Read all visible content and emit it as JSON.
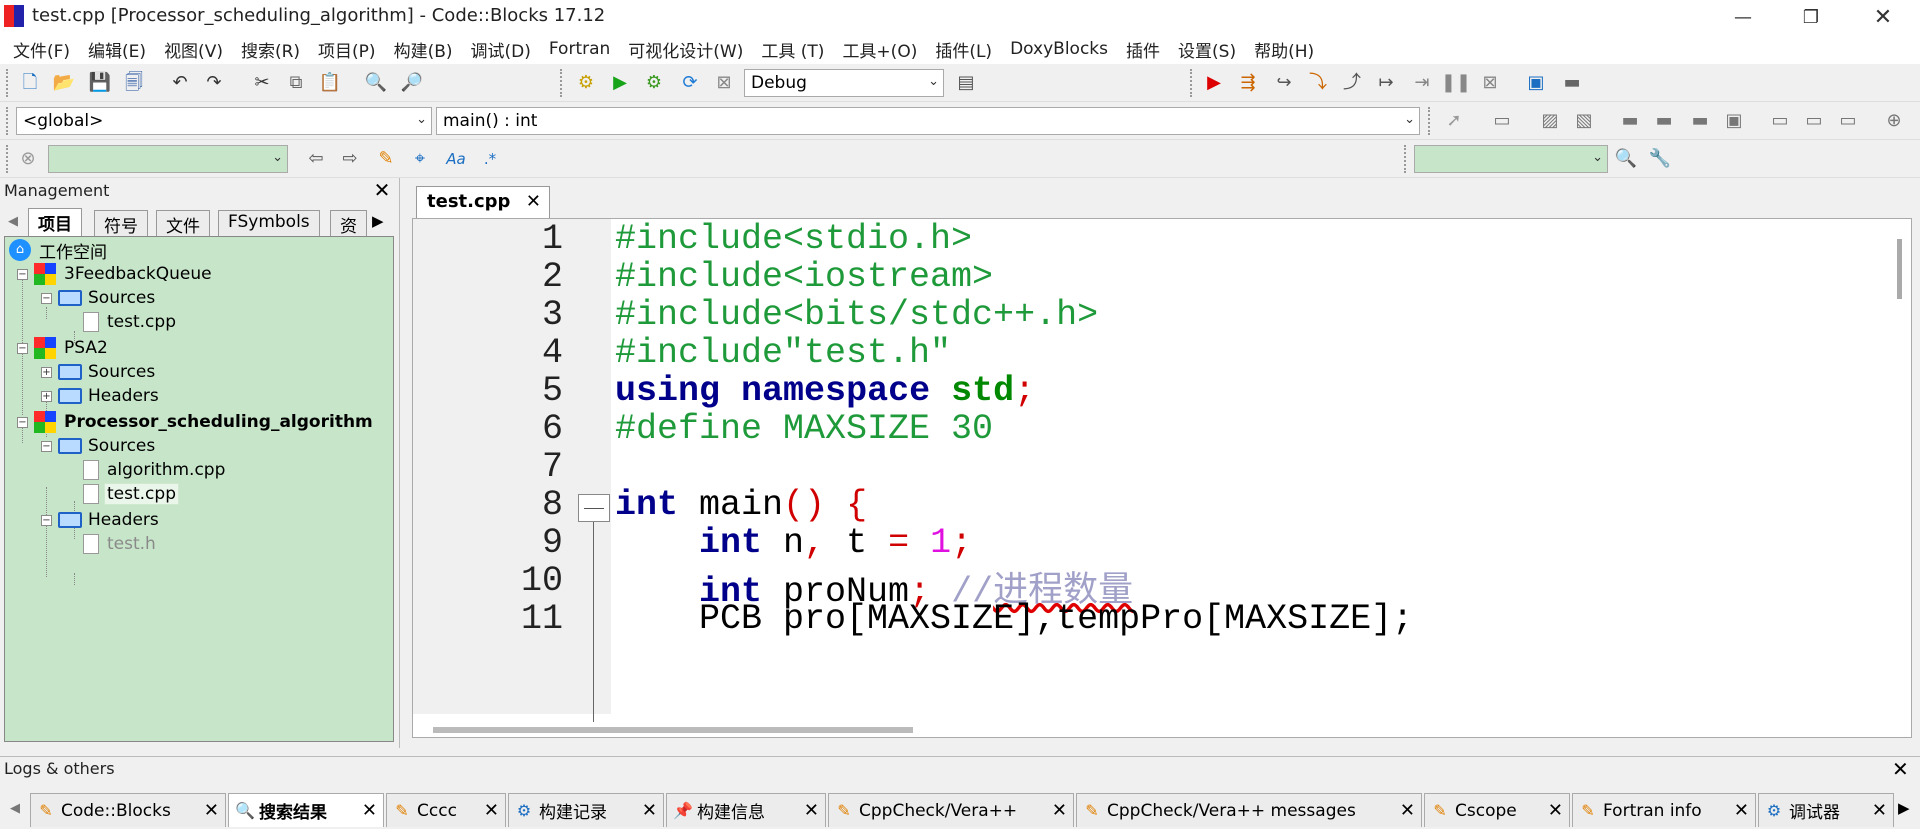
{
  "window": {
    "title": "test.cpp [Processor_scheduling_algorithm] - Code::Blocks 17.12"
  },
  "menu": [
    "文件(F)",
    "编辑(E)",
    "视图(V)",
    "搜索(R)",
    "项目(P)",
    "构建(B)",
    "调试(D)",
    "Fortran",
    "可视化设计(W)",
    "工具 (T)",
    "工具+(O)",
    "插件(L)",
    "DoxyBlocks",
    "插件",
    "设置(S)",
    "帮助(H)"
  ],
  "toolbar": {
    "build_target": "Debug",
    "scope": "<global>",
    "function": "main() : int"
  },
  "management": {
    "title": "Management",
    "tabs": [
      "项目",
      "符号",
      "文件",
      "FSymbols",
      "资"
    ],
    "tree": {
      "workspace": "工作空间",
      "p1": {
        "name": "3FeedbackQueue",
        "sources": "Sources",
        "f1": "test.cpp"
      },
      "p2": {
        "name": "PSA2",
        "sources": "Sources",
        "headers": "Headers"
      },
      "p3": {
        "name": "Processor_scheduling_algorithm",
        "sources": "Sources",
        "f1": "algorithm.cpp",
        "f2": "test.cpp",
        "headers": "Headers",
        "h1": "test.h"
      }
    }
  },
  "editor": {
    "tab": "test.cpp",
    "line_numbers": [
      "1",
      "2",
      "3",
      "4",
      "5",
      "6",
      "7",
      "8",
      "9",
      "10",
      "11"
    ],
    "lines": {
      "l1": "#include<stdio.h>",
      "l2": "#include<iostream>",
      "l3": "#include<bits/stdc++.h>",
      "l4": "#include\"test.h\"",
      "l5_kw1": "using",
      "l5_kw2": "namespace",
      "l5_ns": "std",
      "l5_semi": ";",
      "l6": "#define MAXSIZE 30",
      "l8_kw": "int",
      "l8_name": " main",
      "l8_paren": "()",
      "l8_brace": "{",
      "l9_kw": "int",
      "l9_a": " n",
      "l9_comma": ",",
      "l9_b": " t ",
      "l9_eq": "=",
      "l9_num": "1",
      "l9_semi": ";",
      "l10_kw": "int",
      "l10_name": " proNum",
      "l10_semi": ";",
      "l10_cm": "//",
      "l10_cmz": "进程数量",
      "l11": "PCB pro[MAXSIZE],tempPro[MAXSIZE];"
    }
  },
  "logs": {
    "title": "Logs & others",
    "tabs": [
      "Code::Blocks",
      "搜索结果",
      "Cccc",
      "构建记录",
      "构建信息",
      "CppCheck/Vera++",
      "CppCheck/Vera++ messages",
      "Cscope",
      "Fortran info",
      "调试器"
    ]
  },
  "colors": {
    "tree_bg": "#c7e5c9",
    "preprocessor": "#1f9a3a",
    "keyword": "#00008b",
    "operator": "#d00000",
    "number": "#e010e0",
    "comment": "#a0a0c8"
  }
}
